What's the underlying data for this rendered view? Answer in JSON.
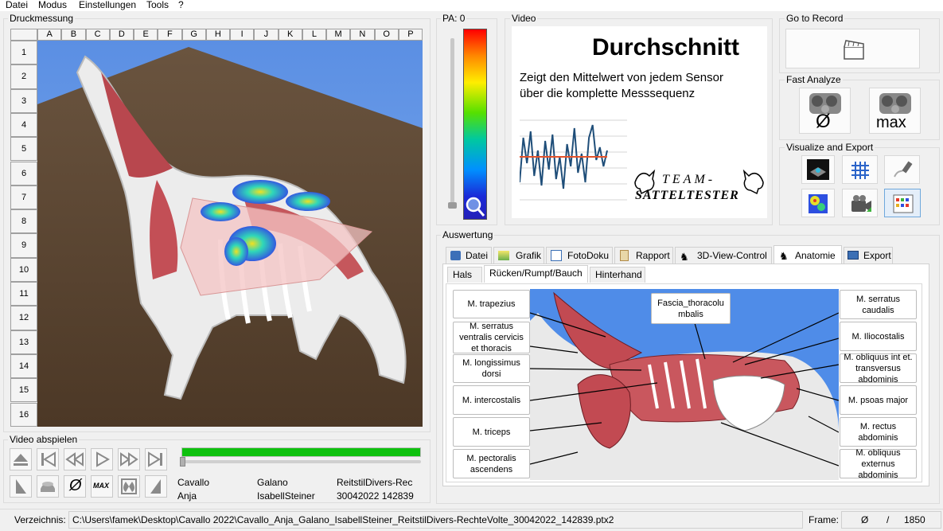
{
  "menu": [
    "Datei",
    "Modus",
    "Einstellungen",
    "Tools",
    "?"
  ],
  "druckmessung": {
    "title": "Druckmessung",
    "columns": [
      "A",
      "B",
      "C",
      "D",
      "E",
      "F",
      "G",
      "H",
      "I",
      "J",
      "K",
      "L",
      "M",
      "N",
      "O",
      "P"
    ],
    "rows": [
      "1",
      "2",
      "3",
      "4",
      "5",
      "6",
      "7",
      "8",
      "9",
      "10",
      "11",
      "12",
      "13",
      "14",
      "15",
      "16"
    ]
  },
  "pa": {
    "label": "PA: 0"
  },
  "video": {
    "title": "Video",
    "heading": "Durchschnitt",
    "desc_line1": "Zeigt den Mittelwert von jedem Sensor",
    "desc_line2": "über die komplette Messsequenz",
    "logo_line1": "TEAM-",
    "logo_line2": "SATTELTESTER",
    "chart_values": [
      10,
      38,
      22,
      42,
      14,
      30,
      8,
      36,
      18,
      40,
      12,
      26,
      6,
      34,
      20,
      44,
      16,
      28,
      10,
      38,
      46,
      24,
      32,
      20,
      30
    ],
    "chart_mean": 26,
    "line_color": "#1f4e79",
    "mean_color": "#e5532b"
  },
  "go_to_record": {
    "title": "Go to Record"
  },
  "fast_analyze": {
    "title": "Fast Analyze",
    "mean_symbol": "Ø",
    "max_label": "max"
  },
  "visualize_export": {
    "title": "Visualize and Export"
  },
  "video_abspielen": {
    "title": "Video abspielen",
    "max_label": "MAX",
    "mean_symbol": "Ø",
    "progress": 1.0,
    "progress_color": "#0ec10e",
    "info": [
      [
        "Cavallo",
        "Galano",
        "ReitstilDivers-Recht"
      ],
      [
        "Anja",
        "IsabellSteiner",
        "30042022 142839"
      ]
    ]
  },
  "auswertung": {
    "title": "Auswertung",
    "tabs": [
      "Datei",
      "Grafik",
      "FotoDoku",
      "Rapport",
      "3D-View-Control",
      "Anatomie",
      "Export"
    ],
    "active_tab": "Anatomie",
    "subtabs": [
      "Hals",
      "Rücken/Rumpf/Bauch",
      "Hinterhand"
    ],
    "active_subtab": "Rücken/Rumpf/Bauch",
    "labels_left": [
      "M. trapezius",
      "M. serratus ventralis cervicis et thoracis",
      "M. longissimus dorsi",
      "M. intercostalis",
      "M. triceps",
      "M. pectoralis ascendens"
    ],
    "labels_right": [
      "M. serratus caudalis",
      "M. Iliocostalis",
      "M. obliquus int et. transversus abdominis",
      "M. psoas major",
      "M. rectus abdominis",
      "M. obliquus externus abdominis"
    ],
    "label_center": "Fascia_thoracolumbalis"
  },
  "statusbar": {
    "dir_label": "Verzeichnis:",
    "path": "C:\\Users\\famek\\Desktop\\Cavallo 2022\\Cavallo_Anja_Galano_IsabellSteiner_ReitstilDivers-RechteVolte_30042022_142839.ptx2",
    "frame_label": "Frame:",
    "frame_mean": "Ø",
    "frame_sep": "/",
    "frame_total": "1850"
  }
}
